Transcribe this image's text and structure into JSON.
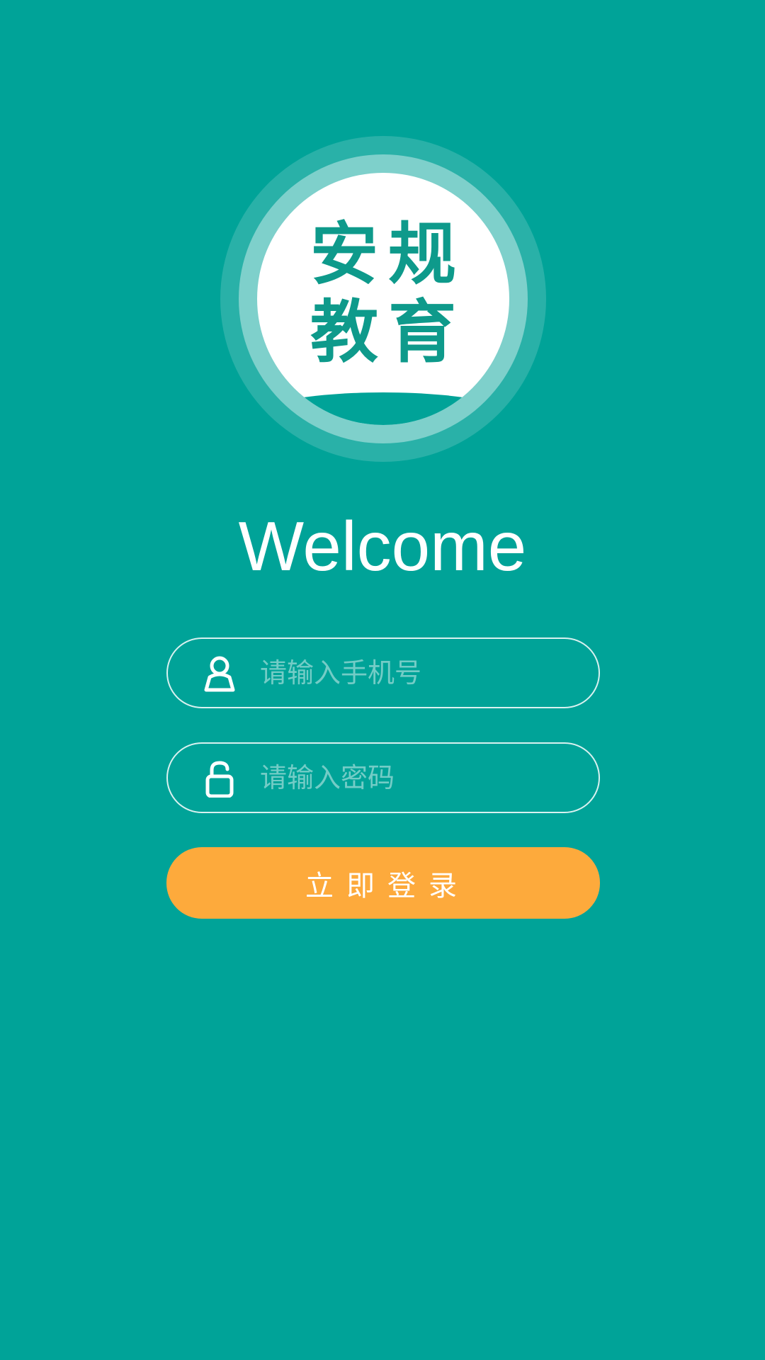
{
  "logo": {
    "line1": "安规",
    "line2": "教育"
  },
  "welcome_title": "Welcome",
  "phone_field": {
    "icon": "user-icon",
    "placeholder": "请输入手机号",
    "value": ""
  },
  "password_field": {
    "icon": "lock-icon",
    "placeholder": "请输入密码",
    "value": ""
  },
  "login_button": {
    "label": "立即登录"
  },
  "colors": {
    "background": "#00A398",
    "button": "#FDAA3C",
    "logo_text": "#0E9A8B"
  }
}
